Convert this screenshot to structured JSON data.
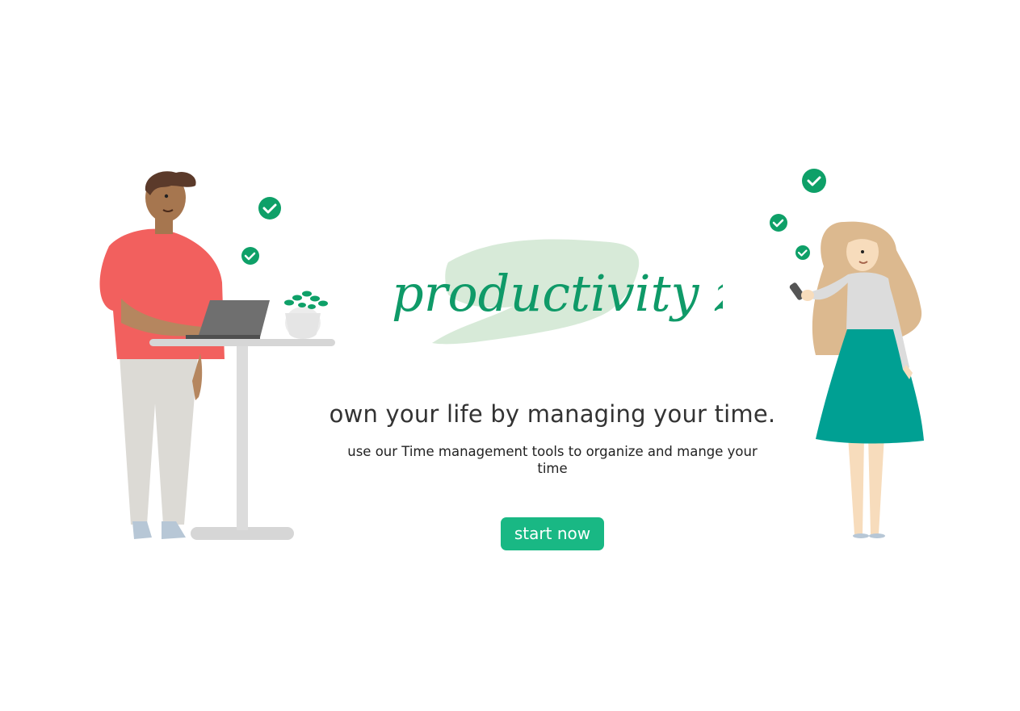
{
  "logo": {
    "text": "productivity zone"
  },
  "hero": {
    "headline": "own your life by managing your time.",
    "subtext": "use our Time management tools to organize and mange your time",
    "cta_label": "start now"
  },
  "colors": {
    "accent": "#19b884",
    "logo_green": "#0f9a68",
    "brush_green": "#d7ead8",
    "check_green": "#0ea068",
    "shirt_red": "#f2605e",
    "skirt_teal": "#00a093"
  },
  "icons": {
    "checks": "check-circle-icon"
  }
}
